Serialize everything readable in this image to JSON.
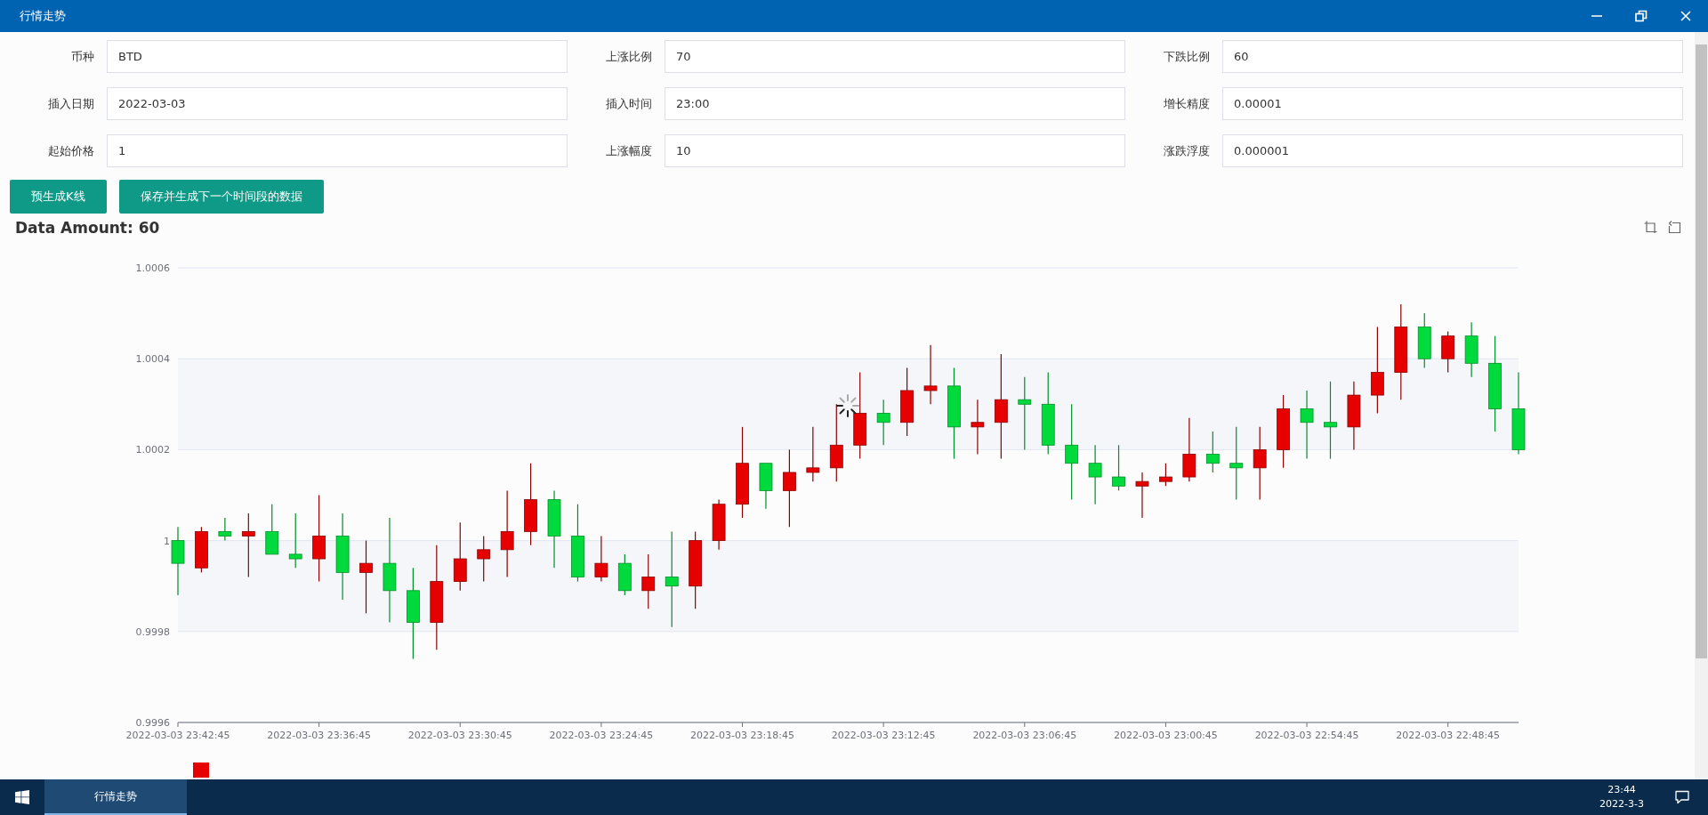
{
  "window": {
    "title": "行情走势"
  },
  "form": {
    "fields": [
      {
        "label": "币种",
        "value": "BTD"
      },
      {
        "label": "上涨比例",
        "value": "70"
      },
      {
        "label": "下跌比例",
        "value": "60"
      },
      {
        "label": "插入日期",
        "value": "2022-03-03"
      },
      {
        "label": "插入时间",
        "value": "23:00"
      },
      {
        "label": "增长精度",
        "value": "0.00001"
      },
      {
        "label": "起始价格",
        "value": "1"
      },
      {
        "label": "上涨幅度",
        "value": "10"
      },
      {
        "label": "涨跌浮度",
        "value": "0.000001"
      }
    ]
  },
  "buttons": [
    "预生成K线",
    "保存并生成下一个时间段的数据"
  ],
  "chart": {
    "title": "Data Amount: 60",
    "chart_data": {
      "type": "candlestick",
      "grid": true,
      "categories": [
        "2022-03-03 23:42:45",
        null,
        null,
        null,
        null,
        null,
        "2022-03-03 23:36:45",
        null,
        null,
        null,
        null,
        null,
        "2022-03-03 23:30:45",
        null,
        null,
        null,
        null,
        null,
        "2022-03-03 23:24:45",
        null,
        null,
        null,
        null,
        null,
        "2022-03-03 23:18:45",
        null,
        null,
        null,
        null,
        null,
        "2022-03-03 23:12:45",
        null,
        null,
        null,
        null,
        null,
        "2022-03-03 23:06:45",
        null,
        null,
        null,
        null,
        null,
        "2022-03-03 23:00:45",
        null,
        null,
        null,
        null,
        null,
        "2022-03-03 22:54:45",
        null,
        null,
        null,
        null,
        null,
        "2022-03-03 22:48:45",
        null,
        null,
        null
      ],
      "ohlc": [
        [
          0.99995,
          1.00003,
          0.99988,
          1
        ],
        [
          1.00002,
          1.00003,
          0.99993,
          0.99994
        ],
        [
          1.00001,
          1.00005,
          1,
          1.00002
        ],
        [
          1.00002,
          1.00006,
          0.99992,
          1.00001
        ],
        [
          0.99997,
          1.00008,
          0.99997,
          1.00002
        ],
        [
          0.99996,
          1.00006,
          0.99994,
          0.99997
        ],
        [
          1.00001,
          1.0001,
          0.99991,
          0.99996
        ],
        [
          0.99993,
          1.00006,
          0.99987,
          1.00001
        ],
        [
          0.99995,
          1,
          0.99984,
          0.99993
        ],
        [
          0.99989,
          1.00005,
          0.99982,
          0.99995
        ],
        [
          0.99982,
          0.99994,
          0.99974,
          0.99989
        ],
        [
          0.99991,
          0.99999,
          0.99976,
          0.99982
        ],
        [
          0.99996,
          1.00004,
          0.99989,
          0.99991
        ],
        [
          0.99998,
          1.00001,
          0.99991,
          0.99996
        ],
        [
          1.00002,
          1.00011,
          0.99992,
          0.99998
        ],
        [
          1.00009,
          1.00017,
          0.99999,
          1.00002
        ],
        [
          1.00001,
          1.00011,
          0.99994,
          1.00009
        ],
        [
          0.99992,
          1.00008,
          0.99991,
          1.00001
        ],
        [
          0.99995,
          1.00001,
          0.99991,
          0.99992
        ],
        [
          0.99989,
          0.99997,
          0.99988,
          0.99995
        ],
        [
          0.99992,
          0.99997,
          0.99985,
          0.99989
        ],
        [
          0.9999,
          1.00002,
          0.99981,
          0.99992
        ],
        [
          1,
          1.00002,
          0.99985,
          0.9999
        ],
        [
          1.00008,
          1.00009,
          0.99998,
          1
        ],
        [
          1.00017,
          1.00025,
          1.00005,
          1.00008
        ],
        [
          1.00011,
          1.00017,
          1.00007,
          1.00017
        ],
        [
          1.00015,
          1.0002,
          1.00003,
          1.00011
        ],
        [
          1.00016,
          1.00025,
          1.00013,
          1.00015
        ],
        [
          1.00021,
          1.0003,
          1.00013,
          1.00016
        ],
        [
          1.00028,
          1.00037,
          1.00018,
          1.00021
        ],
        [
          1.00026,
          1.00031,
          1.00021,
          1.00028
        ],
        [
          1.00033,
          1.00038,
          1.00023,
          1.00026
        ],
        [
          1.00034,
          1.00043,
          1.0003,
          1.00033
        ],
        [
          1.00025,
          1.00038,
          1.00018,
          1.00034
        ],
        [
          1.00026,
          1.00031,
          1.00019,
          1.00025
        ],
        [
          1.00031,
          1.00041,
          1.00018,
          1.00026
        ],
        [
          1.0003,
          1.00036,
          1.0002,
          1.00031
        ],
        [
          1.00021,
          1.00037,
          1.00019,
          1.0003
        ],
        [
          1.00017,
          1.0003,
          1.00009,
          1.00021
        ],
        [
          1.00014,
          1.00021,
          1.00008,
          1.00017
        ],
        [
          1.00012,
          1.00021,
          1.00011,
          1.00014
        ],
        [
          1.00013,
          1.00015,
          1.00005,
          1.00012
        ],
        [
          1.00014,
          1.00017,
          1.00012,
          1.00013
        ],
        [
          1.00019,
          1.00027,
          1.00013,
          1.00014
        ],
        [
          1.00017,
          1.00024,
          1.00015,
          1.00019
        ],
        [
          1.00016,
          1.00025,
          1.00009,
          1.00017
        ],
        [
          1.0002,
          1.00025,
          1.00009,
          1.00016
        ],
        [
          1.00029,
          1.00032,
          1.00016,
          1.0002
        ],
        [
          1.00026,
          1.00033,
          1.00018,
          1.00029
        ],
        [
          1.00025,
          1.00035,
          1.00018,
          1.00026
        ],
        [
          1.00032,
          1.00035,
          1.0002,
          1.00025
        ],
        [
          1.00037,
          1.00047,
          1.00028,
          1.00032
        ],
        [
          1.00047,
          1.00052,
          1.00031,
          1.00037
        ],
        [
          1.0004,
          1.0005,
          1.00038,
          1.00047
        ],
        [
          1.00045,
          1.00046,
          1.00037,
          1.0004
        ],
        [
          1.00039,
          1.00048,
          1.00036,
          1.00045
        ],
        [
          1.00029,
          1.00045,
          1.00024,
          1.00039
        ],
        [
          1.0002,
          1.00037,
          1.00019,
          1.00029
        ]
      ],
      "ylim": [
        0.9996,
        1.0006
      ],
      "yticks": [
        {
          "value": 0.9996,
          "label": "0.9996"
        },
        {
          "value": 0.9998,
          "label": "0.9998"
        },
        {
          "value": 1,
          "label": "1"
        },
        {
          "value": 1.0002,
          "label": "1.0002"
        },
        {
          "value": 1.0004,
          "label": "1.0004"
        },
        {
          "value": 1.0006,
          "label": "1.0006"
        }
      ]
    }
  },
  "taskbar": {
    "items": [
      {
        "label": "行情走势",
        "selected": true
      }
    ],
    "time": "23:44",
    "date": "2022-3-3"
  }
}
